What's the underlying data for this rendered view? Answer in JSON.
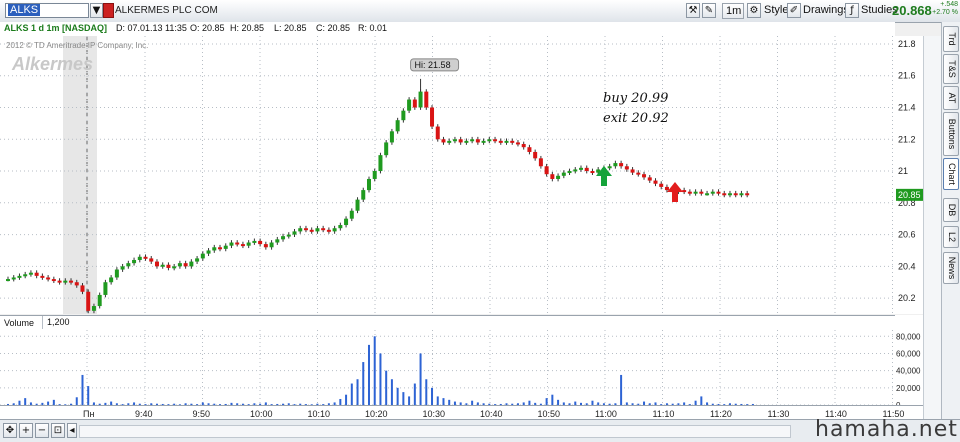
{
  "toolbar": {
    "symbol": "ALKS",
    "company": "ALKERMES PLC COM",
    "interval_btn": "1m",
    "style_btn": "Style",
    "drawings_btn": "Drawings",
    "studies_btn": "Studies",
    "last_price": "20.868",
    "change_abs": "+.548",
    "change_pct": "+2.70 %"
  },
  "info": {
    "title": "ALKS 1 d 1m [NASDAQ]",
    "date": "D: 07.01.13 11:35",
    "open": "O: 20.85",
    "high": "H: 20.85",
    "low": "L: 20.85",
    "close": "C: 20.85",
    "range": "R: 0.01"
  },
  "chart": {
    "copyright": "2012 © TD Ameritrade IP Company, Inc.",
    "logo": "Alkermes",
    "hi_label": "Hi: 21.58",
    "note_buy": "buy 20.99",
    "note_exit": "exit 20.92",
    "current_price": "20.85",
    "colors": {
      "up": "#1f9a1f",
      "down": "#d91414",
      "grid": "#b7bec6",
      "arrow_buy": "#14a33a",
      "arrow_exit": "#e21d1d",
      "volume": "#2d63d4"
    }
  },
  "volume": {
    "label": "Volume",
    "value": "1,200",
    "axis_ticks": [
      "80,000",
      "60,000",
      "40,000",
      "20,000",
      "0"
    ]
  },
  "chart_data": {
    "type": "candlestick",
    "price_axis_ticks": [
      "21.8",
      "21.6",
      "21.4",
      "21.2",
      "21",
      "20.8",
      "20.6",
      "20.4",
      "20.2"
    ],
    "ylim": [
      20.1,
      21.85
    ],
    "time_ticks": [
      "Пн",
      "9:40",
      "9:50",
      "10:00",
      "10:10",
      "10:20",
      "10:30",
      "10:40",
      "10:50",
      "11:00",
      "11:10",
      "11:20",
      "11:30",
      "11:40",
      "11:50"
    ],
    "session_start": "9:30",
    "minutes_per_bar": 1,
    "closes": [
      20.32,
      20.33,
      20.34,
      20.35,
      20.36,
      20.34,
      20.33,
      20.32,
      20.31,
      20.3,
      20.31,
      20.3,
      20.28,
      20.24,
      20.12,
      20.15,
      20.22,
      20.3,
      20.33,
      20.38,
      20.4,
      20.42,
      20.44,
      20.46,
      20.45,
      20.43,
      20.4,
      20.41,
      20.39,
      20.4,
      20.42,
      20.4,
      20.43,
      20.45,
      20.48,
      20.5,
      20.52,
      20.51,
      20.53,
      20.55,
      20.54,
      20.53,
      20.55,
      20.56,
      20.54,
      20.52,
      20.55,
      20.57,
      20.59,
      20.6,
      20.62,
      20.64,
      20.63,
      20.62,
      20.64,
      20.63,
      20.62,
      20.64,
      20.66,
      20.7,
      20.75,
      20.82,
      20.88,
      20.95,
      21.0,
      21.1,
      21.18,
      21.25,
      21.32,
      21.38,
      21.45,
      21.4,
      21.5,
      21.4,
      21.28,
      21.2,
      21.18,
      21.19,
      21.2,
      21.18,
      21.19,
      21.2,
      21.18,
      21.19,
      21.2,
      21.19,
      21.18,
      21.19,
      21.18,
      21.17,
      21.15,
      21.12,
      21.08,
      21.03,
      20.98,
      20.95,
      20.97,
      20.99,
      21.0,
      21.01,
      21.02,
      21.0,
      20.99,
      21.01,
      21.02,
      21.03,
      21.05,
      21.03,
      21.01,
      20.99,
      20.98,
      20.96,
      20.94,
      20.92,
      20.9,
      20.88,
      20.87,
      20.88,
      20.87,
      20.86,
      20.87,
      20.86,
      20.86,
      20.87,
      20.86,
      20.85,
      20.86,
      20.85,
      20.86,
      20.85
    ],
    "volumes": [
      1200,
      2000,
      5000,
      8000,
      3000,
      1500,
      2500,
      4000,
      6000,
      1000,
      800,
      1500,
      9000,
      35000,
      22000,
      3000,
      1500,
      2500,
      4000,
      2000,
      1000,
      2000,
      3000,
      1500,
      1000,
      2000,
      1500,
      1200,
      1000,
      1500,
      800,
      2000,
      1500,
      1000,
      3000,
      2000,
      1500,
      1000,
      1200,
      2500,
      2000,
      1500,
      1000,
      2000,
      1500,
      3000,
      1000,
      1200,
      1500,
      2000,
      1000,
      1500,
      1000,
      800,
      1500,
      1000,
      2000,
      3000,
      7000,
      12000,
      25000,
      30000,
      50000,
      70000,
      80000,
      60000,
      40000,
      30000,
      20000,
      15000,
      10000,
      25000,
      60000,
      30000,
      20000,
      10000,
      8000,
      6000,
      4000,
      3000,
      2000,
      5000,
      3000,
      2000,
      1500,
      1000,
      1200,
      2000,
      1500,
      2000,
      3000,
      5000,
      2500,
      1500,
      8000,
      12000,
      6000,
      3000,
      2000,
      4000,
      2500,
      2000,
      5000,
      3000,
      2000,
      1500,
      2000,
      35000,
      3000,
      2000,
      1500,
      4000,
      2000,
      3000,
      1000,
      2000,
      1500,
      2000,
      3000,
      1000,
      5000,
      10000,
      3000,
      1500,
      1200,
      1000,
      2000,
      1500,
      1200,
      1000,
      1200
    ]
  }
}
